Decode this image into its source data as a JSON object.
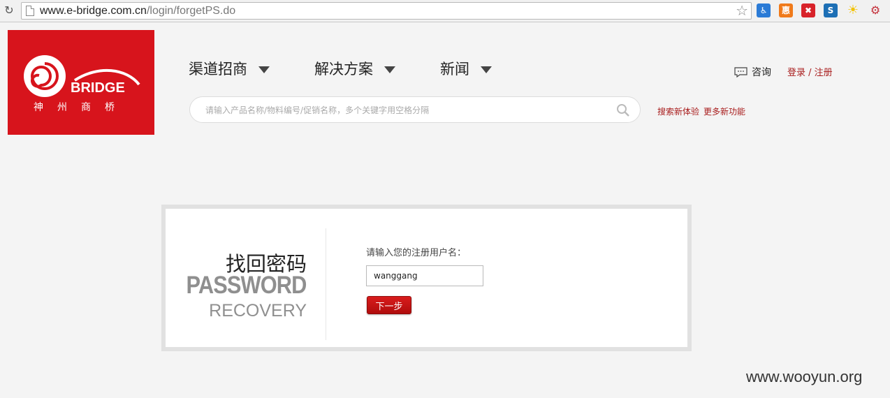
{
  "browser": {
    "reload_icon": "reload-icon",
    "url_host": "www.e-bridge.com.cn",
    "url_path": "/login/forgetPS.do",
    "extensions": [
      "accessibility-extension-icon",
      "hui-extension-icon",
      "close-extension-icon",
      "s-extension-icon",
      "sun-extension-icon",
      "rss-extension-icon"
    ]
  },
  "logo": {
    "word": "BRIDGE",
    "cn": "神州商桥"
  },
  "nav": {
    "items": [
      {
        "label": "渠道招商"
      },
      {
        "label": "解决方案"
      },
      {
        "label": "新闻"
      }
    ]
  },
  "header": {
    "consult_label": "咨询",
    "auth_label": "登录 / 注册"
  },
  "search": {
    "placeholder": "请输入产品名称/物料编号/促销名称，多个关键字用空格分隔",
    "link1": "搜索新体验",
    "link2": "更多新功能"
  },
  "card": {
    "title_cn": "找回密码",
    "title_en1": "PASSWORD",
    "title_en2": "RECOVERY",
    "prompt": "请输入您的注册用户名：",
    "username_value": "wanggang",
    "next_label": "下一步"
  },
  "watermark": "www.wooyun.org",
  "colors": {
    "brand_red": "#d7141c",
    "link_red": "#a81c1c",
    "page_bg": "#f4f4f4"
  }
}
